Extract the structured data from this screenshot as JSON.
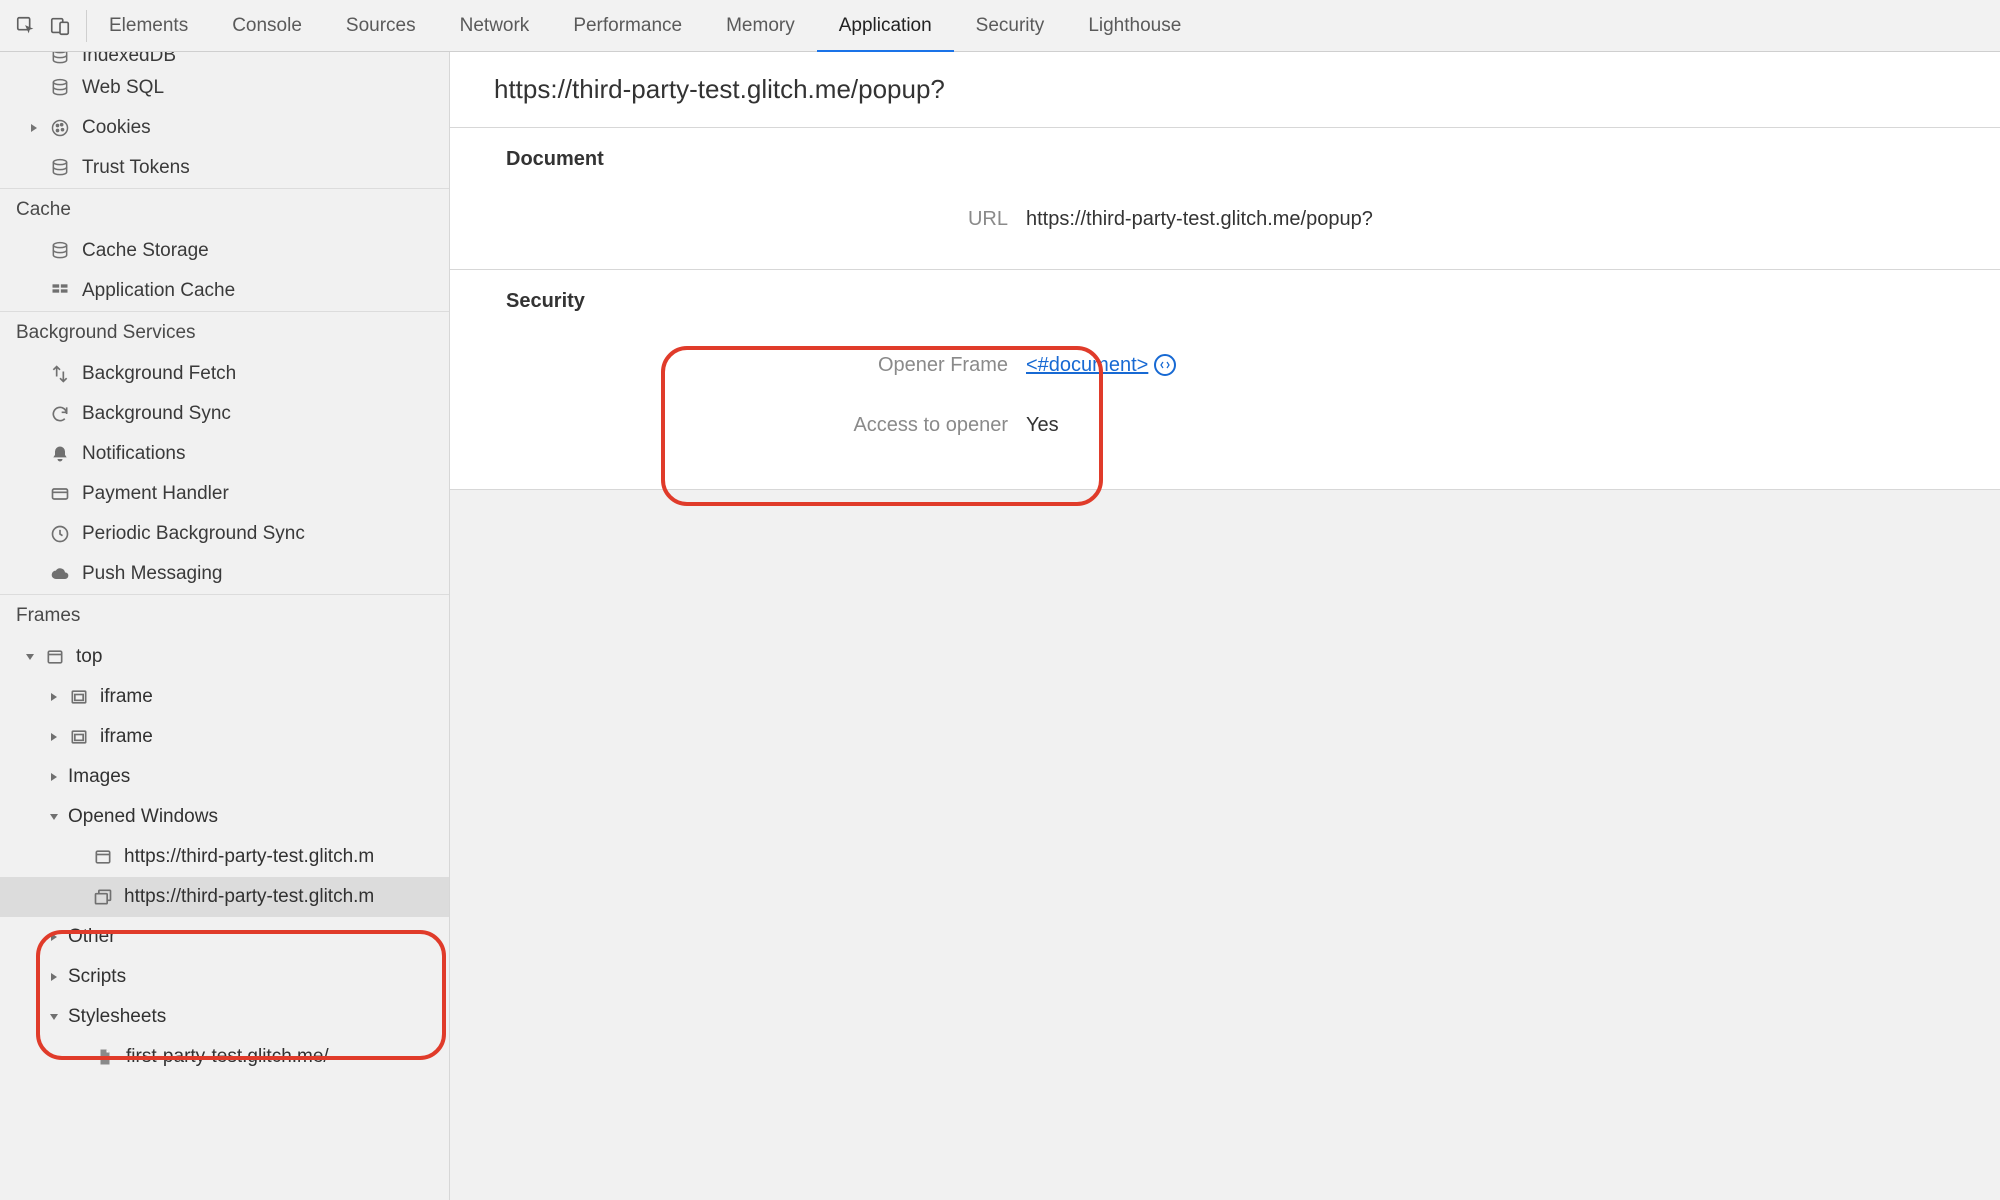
{
  "tabs": {
    "items": [
      "Elements",
      "Console",
      "Sources",
      "Network",
      "Performance",
      "Memory",
      "Application",
      "Security",
      "Lighthouse"
    ],
    "active": "Application"
  },
  "sidebar": {
    "storage_items": {
      "indexeddb": "IndexedDB",
      "websql": "Web SQL",
      "cookies": "Cookies",
      "trust_tokens": "Trust Tokens"
    },
    "cache_heading": "Cache",
    "cache_items": {
      "cache_storage": "Cache Storage",
      "app_cache": "Application Cache"
    },
    "bg_heading": "Background Services",
    "bg_items": {
      "bg_fetch": "Background Fetch",
      "bg_sync": "Background Sync",
      "notifications": "Notifications",
      "payment": "Payment Handler",
      "periodic": "Periodic Background Sync",
      "push": "Push Messaging"
    },
    "frames_heading": "Frames",
    "frames": {
      "top": "top",
      "iframe1": "iframe",
      "iframe2": "iframe",
      "images": "Images",
      "opened_windows": "Opened Windows",
      "win1": "https://third-party-test.glitch.m",
      "win2": "https://third-party-test.glitch.m",
      "other": "Other",
      "scripts": "Scripts",
      "stylesheets": "Stylesheets",
      "stylesheet1": "first-party-test.glitch.me/"
    }
  },
  "content": {
    "page_url": "https://third-party-test.glitch.me/popup?",
    "document_title": "Document",
    "document": {
      "url_label": "URL",
      "url_value": "https://third-party-test.glitch.me/popup?"
    },
    "security_title": "Security",
    "security": {
      "opener_label": "Opener Frame",
      "opener_value": "<#document>",
      "access_label": "Access to opener",
      "access_value": "Yes"
    }
  }
}
